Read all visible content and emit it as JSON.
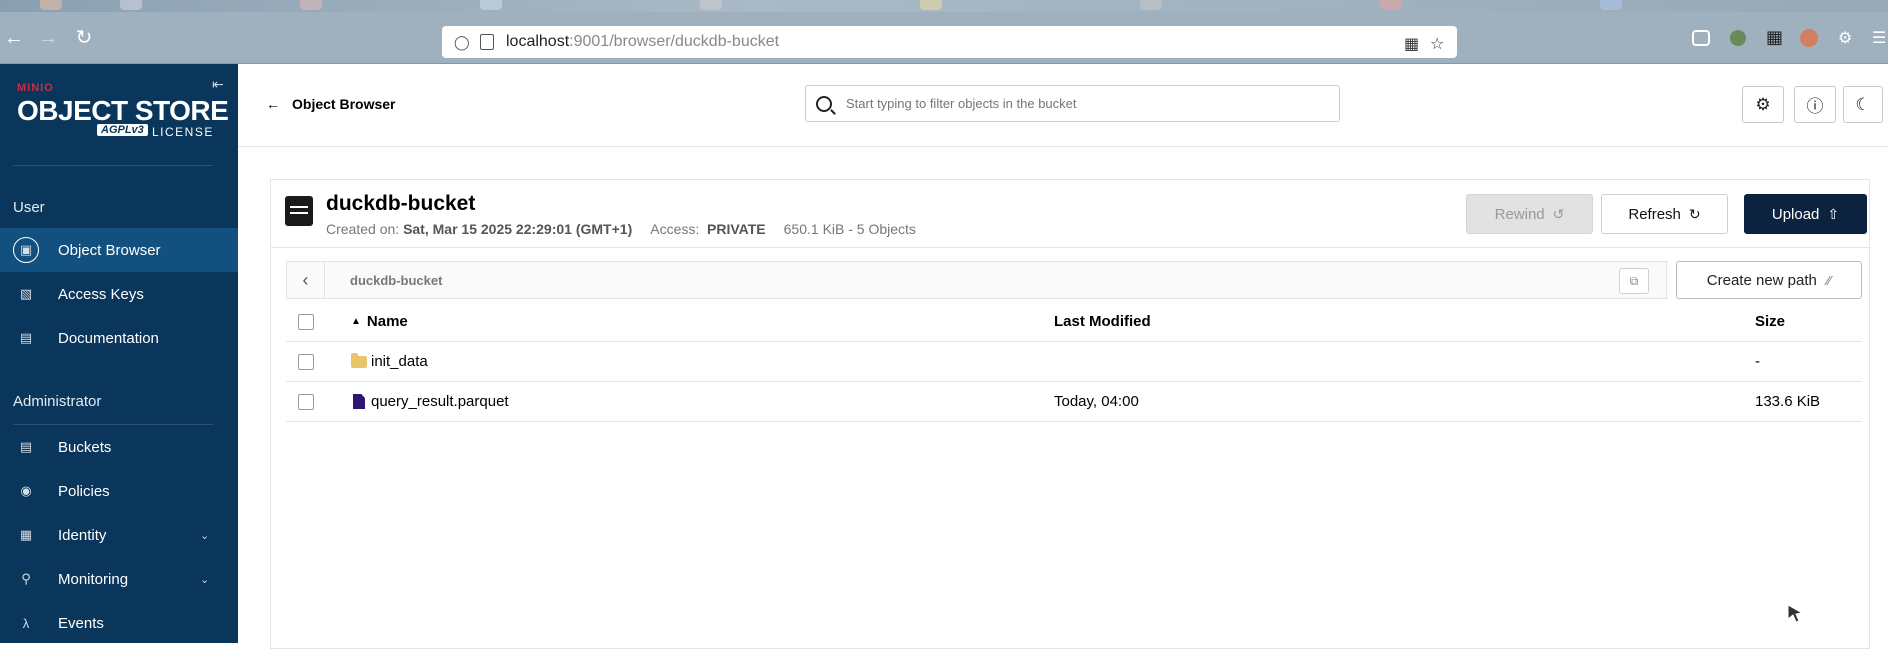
{
  "browser": {
    "url_host": "localhost",
    "url_rest": ":9001/browser/duckdb-bucket"
  },
  "sidebar": {
    "logo": {
      "small": "MINIO",
      "main": "OBJECT STORE",
      "mark": "AGPLv3",
      "license": "LICENSE"
    },
    "sections": [
      {
        "title": "User",
        "items": [
          {
            "label": "Object Browser",
            "icon": "object-browser-icon",
            "active": true
          },
          {
            "label": "Access Keys",
            "icon": "key-icon"
          },
          {
            "label": "Documentation",
            "icon": "documentation-icon"
          }
        ]
      },
      {
        "title": "Administrator",
        "items": [
          {
            "label": "Buckets",
            "icon": "bucket-icon"
          },
          {
            "label": "Policies",
            "icon": "policy-icon"
          },
          {
            "label": "Identity",
            "icon": "identity-icon",
            "expandable": true
          },
          {
            "label": "Monitoring",
            "icon": "monitoring-icon",
            "expandable": true
          },
          {
            "label": "Events",
            "icon": "lambda-icon"
          }
        ]
      }
    ]
  },
  "header": {
    "back_label": "Object Browser",
    "search_placeholder": "Start typing to filter objects in the bucket"
  },
  "bucket": {
    "name": "duckdb-bucket",
    "created_label": "Created on:",
    "created_value": "Sat, Mar 15 2025 22:29:01 (GMT+1)",
    "access_label": "Access:",
    "access_value": "PRIVATE",
    "usage": "650.1 KiB - 5 Objects"
  },
  "actions": {
    "rewind": "Rewind",
    "refresh": "Refresh",
    "upload": "Upload",
    "create_path": "Create new path"
  },
  "breadcrumb": {
    "path": "duckdb-bucket"
  },
  "table": {
    "columns": {
      "name": "Name",
      "modified": "Last Modified",
      "size": "Size"
    },
    "rows": [
      {
        "name": "init_data",
        "type": "folder",
        "modified": "",
        "size": "-"
      },
      {
        "name": "query_result.parquet",
        "type": "file",
        "modified": "Today, 04:00",
        "size": "133.6 KiB"
      }
    ]
  },
  "colors": {
    "sidebar_bg": "#09365a",
    "sidebar_active": "#12507f",
    "upload_bg": "#0c2340",
    "folder": "#e9c46a",
    "file": "#2d1770"
  }
}
